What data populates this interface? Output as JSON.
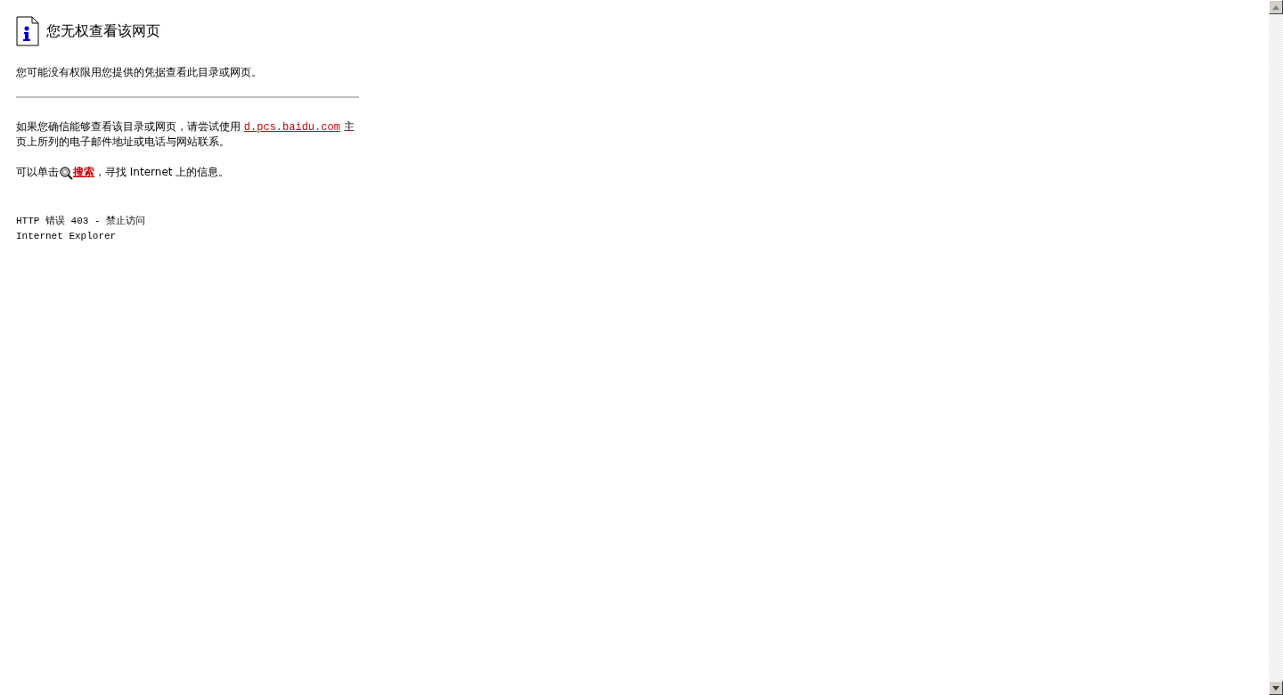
{
  "title": "您无权查看该网页",
  "subtitle": "您可能没有权限用您提供的凭据查看此目录或网页。",
  "contact": {
    "before": "如果您确信能够查看该目录或网页，请尝试使用 ",
    "link": "d.pcs.baidu.com",
    "after": " 主页上所列的电子邮件地址或电话与网站联系。"
  },
  "search": {
    "before": "可以单击",
    "link": "搜索",
    "after": "，寻找 Internet 上的信息。"
  },
  "error": "HTTP 错误 403 - 禁止访问",
  "browser": "Internet Explorer"
}
